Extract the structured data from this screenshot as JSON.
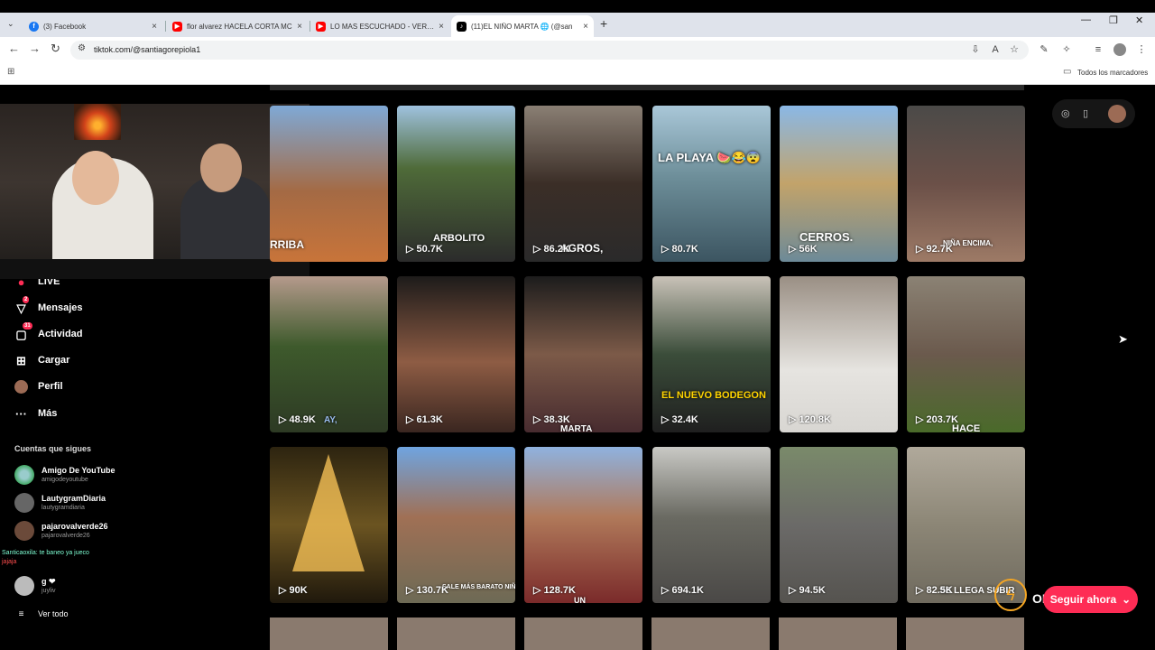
{
  "browser": {
    "tabs": [
      {
        "title": "(3) Facebook",
        "favicon_color": "#1877f2",
        "favicon": "f"
      },
      {
        "title": "flor alvarez HACELA CORTA MC",
        "favicon_color": "#ff0000",
        "favicon": "▶"
      },
      {
        "title": "LO MAS ESCUCHADO - VERAN",
        "favicon_color": "#ff0000",
        "favicon": "▶"
      },
      {
        "title": "(11)EL NIÑO MARTA 🌐 (@san",
        "favicon_color": "#000000",
        "favicon": "♪"
      }
    ],
    "new_tab": "+",
    "url": "tiktok.com/@santiagorepiola1",
    "bookmarks_label": "Todos los marcadores"
  },
  "sidebar": {
    "items": [
      {
        "label": "LIVE",
        "icon": "live-icon",
        "glyph": "●"
      },
      {
        "label": "Mensajes",
        "icon": "messages-icon",
        "glyph": "▽",
        "badge": "2"
      },
      {
        "label": "Actividad",
        "icon": "activity-icon",
        "glyph": "▢",
        "badge": "31"
      },
      {
        "label": "Cargar",
        "icon": "upload-icon",
        "glyph": "⊞"
      },
      {
        "label": "Perfil",
        "icon": "profile-icon",
        "glyph": "●"
      },
      {
        "label": "Más",
        "icon": "more-icon",
        "glyph": "···"
      }
    ],
    "following_title": "Cuentas que sigues",
    "accounts": [
      {
        "name": "Amigo De YouTube",
        "handle": "amigodeyoutube"
      },
      {
        "name": "LautygramDiaria",
        "handle": "lautygramdiaria"
      },
      {
        "name": "pajarovalverde26",
        "handle": "pajarovalverde26"
      },
      {
        "name": "g ❤",
        "handle": "juyliv"
      }
    ],
    "see_all": "Ver todo"
  },
  "chat": {
    "line1": "Santicaoxila: te baneo ya jueco",
    "line2": "jajaja"
  },
  "videos": [
    {
      "views": "",
      "caption": "RRIBA"
    },
    {
      "views": "50.7K",
      "caption": "ARBOLITO"
    },
    {
      "views": "86.2K",
      "caption": "AGROS,"
    },
    {
      "views": "80.7K",
      "caption": "LA PLAYA 🍉😂😨"
    },
    {
      "views": "56K",
      "caption": "CERROS."
    },
    {
      "views": "92.7K",
      "caption": "NIÑA ENCIMA,"
    },
    {
      "views": "48.9K",
      "caption": "AY,"
    },
    {
      "views": "61.3K",
      "caption": ""
    },
    {
      "views": "38.3K",
      "caption": "MARTA"
    },
    {
      "views": "32.4K",
      "caption": "EL NUEVO BODEGON"
    },
    {
      "views": "120.8K",
      "caption": ""
    },
    {
      "views": "203.7K",
      "caption": "HACE"
    },
    {
      "views": "90K",
      "caption": ""
    },
    {
      "views": "130.7K",
      "caption": "SALE MÁS BARATO NIÑA"
    },
    {
      "views": "128.7K",
      "caption": "UN"
    },
    {
      "views": "694.1K",
      "caption": ""
    },
    {
      "views": "94.5K",
      "caption": ""
    },
    {
      "views": "82.5K",
      "caption": "SE LLEGA SUBIR"
    }
  ],
  "overlay": {
    "onpower_text": "ONPOWER",
    "button_label": "Seguir ahora"
  },
  "colors": {
    "tiktok_red": "#fe2c55",
    "tab_strip": "#dfe3eb"
  }
}
